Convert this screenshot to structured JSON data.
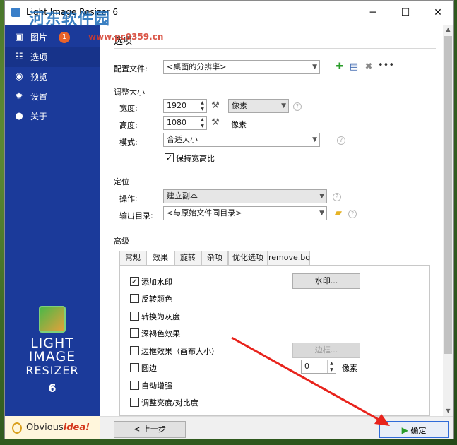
{
  "window": {
    "title": "Light Image Resizer 6",
    "minimize_glyph": "─",
    "maximize_glyph": "☐",
    "close_glyph": "✕"
  },
  "watermark": {
    "text": "河东软件园",
    "url_text": "www.pc0359.cn"
  },
  "sidebar": {
    "items": [
      {
        "label": "图片",
        "icon": "image-icon"
      },
      {
        "label": "选项",
        "icon": "sliders-icon"
      },
      {
        "label": "预览",
        "icon": "eye-icon"
      },
      {
        "label": "设置",
        "icon": "gear-icon"
      },
      {
        "label": "关于",
        "icon": "info-icon"
      }
    ],
    "badge": "1",
    "logo_line1": "LIGHT",
    "logo_line2": "IMAGE",
    "logo_line3": "RESIZER",
    "logo_version": "6",
    "brand_prefix": "Obvious",
    "brand_suffix": "idea!"
  },
  "page": {
    "title": "选项",
    "config_label": "配置文件:",
    "config_value": "<桌面的分辨率>",
    "resize_section": "调整大小",
    "width_label": "宽度:",
    "width_value": "1920",
    "unit_value": "像素",
    "height_label": "高度:",
    "height_value": "1080",
    "height_unit": "像素",
    "mode_label": "模式:",
    "mode_value": "合适大小",
    "keep_ratio_label": "保持宽高比",
    "keep_ratio_checked": true,
    "position_section": "定位",
    "operation_label": "操作:",
    "operation_value": "建立副本",
    "output_label": "输出目录:",
    "output_value": "<与原始文件同目录>",
    "advanced_section": "高级"
  },
  "tabs": [
    {
      "label": "常规"
    },
    {
      "label": "效果"
    },
    {
      "label": "旋转"
    },
    {
      "label": "杂项"
    },
    {
      "label": "优化选项"
    },
    {
      "label": "remove.bg"
    }
  ],
  "effects": {
    "watermark_label": "添加水印",
    "watermark_checked": true,
    "watermark_button": "水印...",
    "invert_label": "反转颜色",
    "grayscale_label": "转换为灰度",
    "sepia_label": "深褐色效果",
    "border_label": "边框效果（画布大小）",
    "border_button": "边框...",
    "round_label": "圆边",
    "round_value": "0",
    "round_unit": "像素",
    "auto_enhance_label": "自动增强",
    "brightness_label": "调整亮度/对比度"
  },
  "footer": {
    "back_button": "< 上一步",
    "ok_button": "确定"
  },
  "colors": {
    "sidebar": "#1b3a9a",
    "ok_accent": "#2a9d2a",
    "annotation_arrow": "#e8231c"
  }
}
